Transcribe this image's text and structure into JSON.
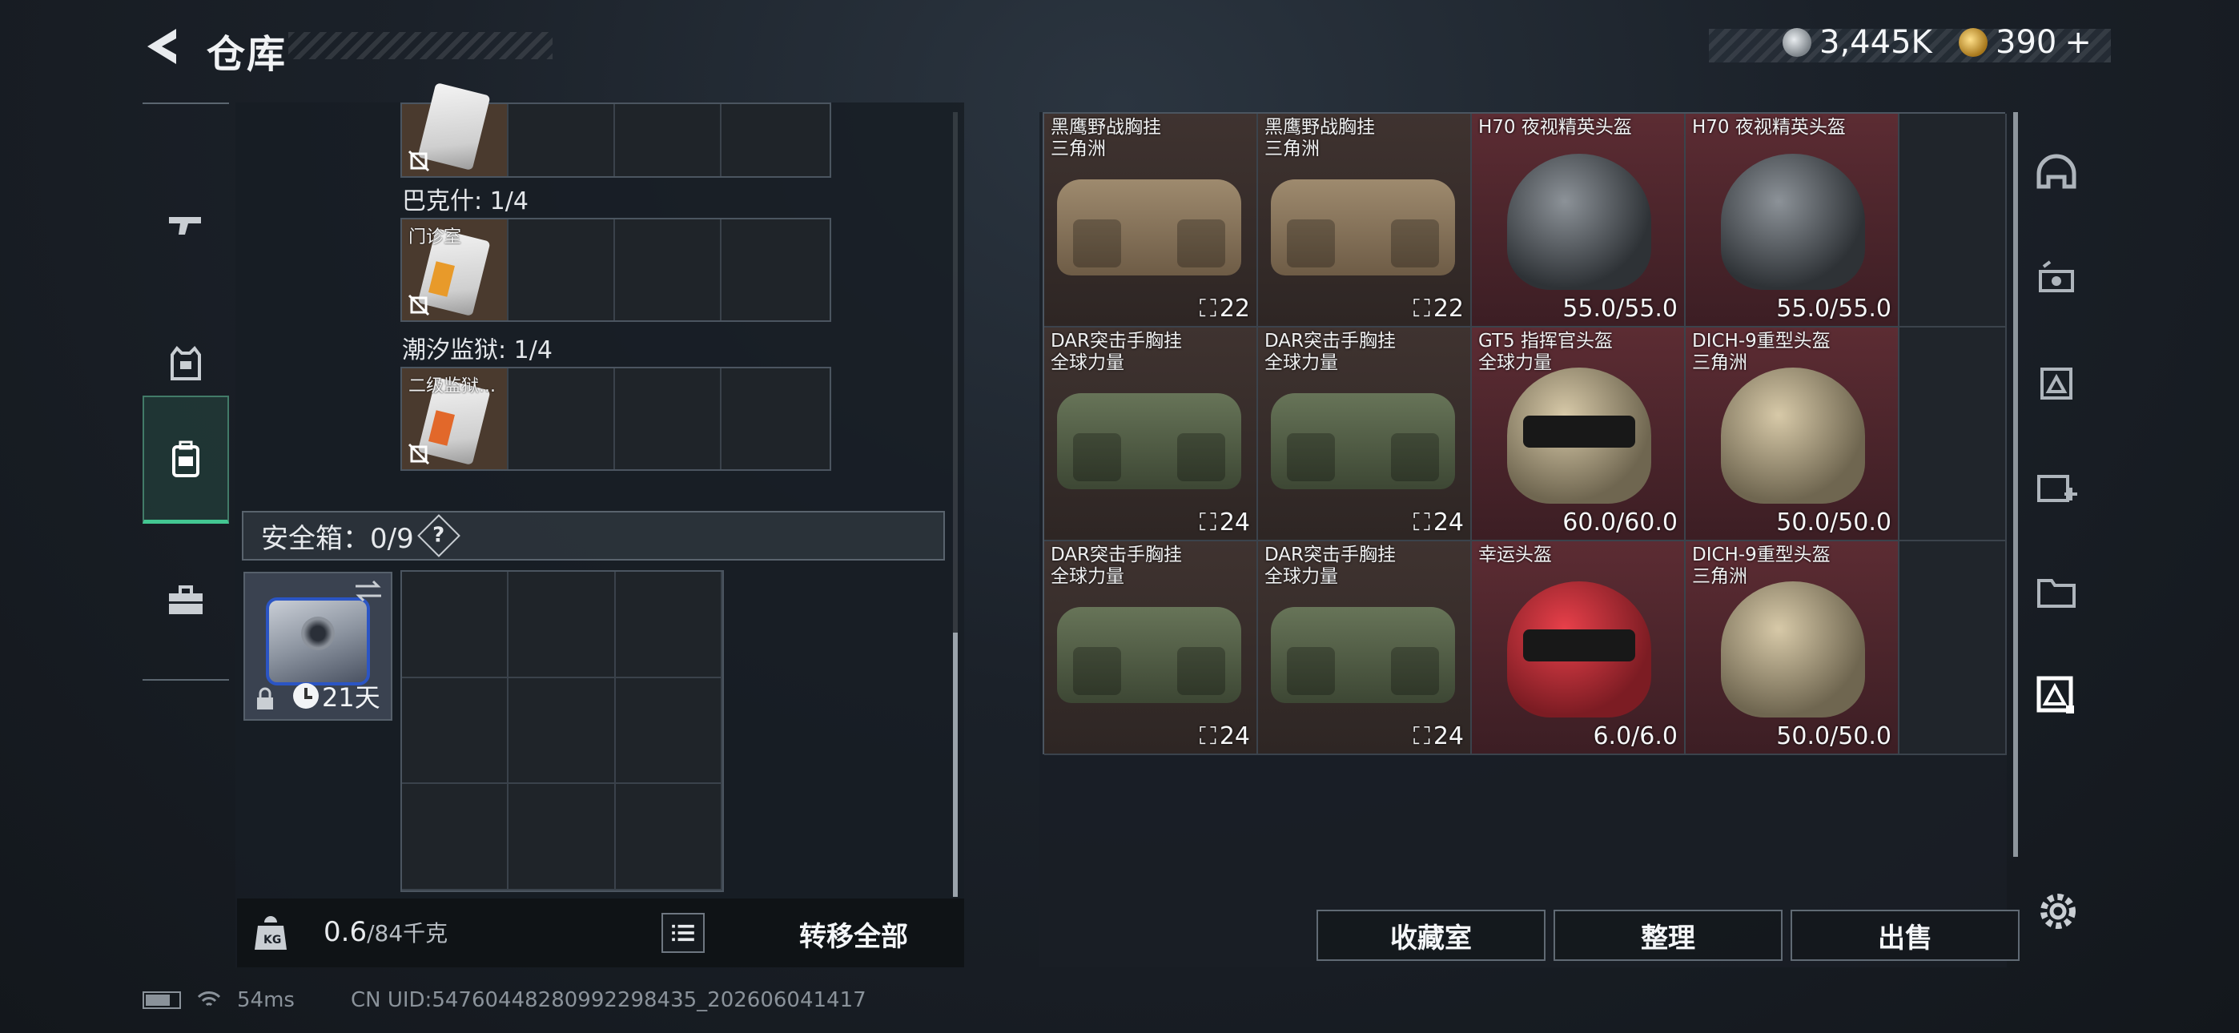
{
  "header": {
    "title": "仓库",
    "currency_1": "3,445K",
    "currency_2": "390",
    "currency_2_add": "+"
  },
  "left_panel": {
    "containers": [
      {
        "label": "巴克什: 1/4",
        "item_label": "门诊室"
      },
      {
        "label": "潮汐监狱: 1/4",
        "item_label": "二级监狱..."
      }
    ],
    "safe_label": "安全箱：0/9",
    "safe_help": "?",
    "safebox_timer": "21天",
    "weight_current": "0.6",
    "weight_max": "/84千克",
    "transfer_all": "转移全部"
  },
  "stash": {
    "items": [
      {
        "name1": "黑鹰野战胸挂",
        "name2": "三角洲",
        "value": "22",
        "kind": "bag",
        "color": "tan"
      },
      {
        "name1": "黑鹰野战胸挂",
        "name2": "三角洲",
        "value": "22",
        "kind": "bag",
        "color": "tan"
      },
      {
        "name1": "H70 夜视精英头盔",
        "name2": "",
        "value": "55.0/55.0",
        "kind": "helmet",
        "color": "dark"
      },
      {
        "name1": "H70 夜视精英头盔",
        "name2": "",
        "value": "55.0/55.0",
        "kind": "helmet",
        "color": "dark"
      },
      {
        "name1": "DAR突击手胸挂",
        "name2": "全球力量",
        "value": "24",
        "kind": "bag",
        "color": "green"
      },
      {
        "name1": "DAR突击手胸挂",
        "name2": "全球力量",
        "value": "24",
        "kind": "bag",
        "color": "green"
      },
      {
        "name1": "GT5 指挥官头盔",
        "name2": "全球力量",
        "value": "60.0/60.0",
        "kind": "helmet",
        "color": "camo"
      },
      {
        "name1": "DICH-9重型头盔",
        "name2": "三角洲",
        "value": "50.0/50.0",
        "kind": "helmet",
        "color": "camo"
      },
      {
        "name1": "DAR突击手胸挂",
        "name2": "全球力量",
        "value": "24",
        "kind": "bag",
        "color": "green"
      },
      {
        "name1": "DAR突击手胸挂",
        "name2": "全球力量",
        "value": "24",
        "kind": "bag",
        "color": "green"
      },
      {
        "name1": "幸运头盔",
        "name2": "",
        "value": "6.0/6.0",
        "kind": "helmet",
        "color": "red"
      },
      {
        "name1": "DICH-9重型头盔",
        "name2": "三角洲",
        "value": "50.0/50.0",
        "kind": "helmet",
        "color": "camo"
      }
    ]
  },
  "actions": {
    "collection": "收藏室",
    "organize": "整理",
    "sell": "出售"
  },
  "status": {
    "ping": "54ms",
    "uid": "CN UID:5476044828099229843​5_202606041417"
  },
  "icons": {
    "left_tabs": [
      "pistol-icon",
      "armor-vest-icon",
      "backpack-icon",
      "toolbox-icon"
    ],
    "right_tabs": [
      "helmet-icon",
      "attachment-icon",
      "tier-icon",
      "add-container-icon",
      "folder-icon",
      "stash-icon"
    ]
  },
  "colors": {
    "accent_green": "#43c792",
    "bag_bg": "#3f3330",
    "helmet_bg": "#5c2c33"
  }
}
